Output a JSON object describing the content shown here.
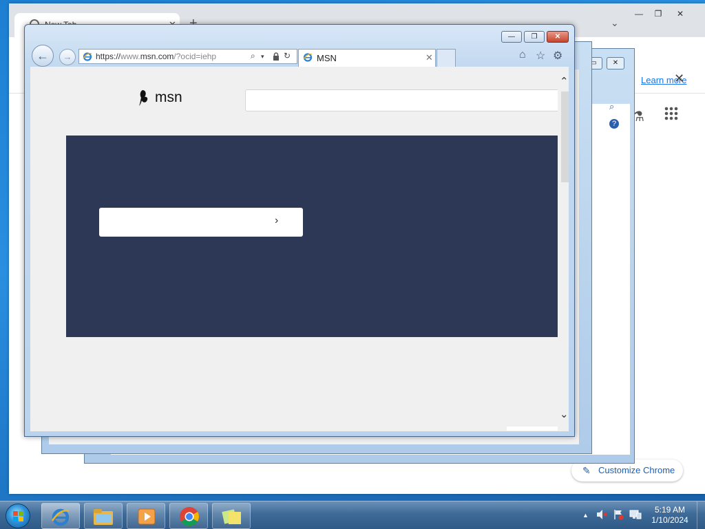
{
  "chrome_window": {
    "tab_title": "New Tab",
    "newtab_glyph": "+",
    "close_glyph": "✕",
    "tab_search_glyph": "⌄",
    "minimize_glyph": "—",
    "maximize_glyph": "❐",
    "close_window_glyph": "✕",
    "infobar_link": "Learn more",
    "infobar_close_glyph": "✕",
    "star_glyph": "☆",
    "menu_glyph": "⋮",
    "labs_glyph": "⚗",
    "customize_label": "Customize Chrome",
    "customize_icon": "pencil-icon"
  },
  "ie_background_window": {
    "caption_buttons": [
      "▭",
      "✕"
    ]
  },
  "ie_window": {
    "caption": {
      "minimize": "—",
      "maximize": "❐",
      "close": "✕"
    },
    "nav": {
      "back_glyph": "←",
      "forward_glyph": "→"
    },
    "address": {
      "url_prefix": "https://",
      "url_host": "www.msn.com",
      "url_path": "/?ocid=iehp",
      "search_glyph": "⌕",
      "dropdown_glyph": "▾",
      "lock_glyph": "🔒",
      "refresh_glyph": "↻"
    },
    "tab": {
      "title": "MSN",
      "close_glyph": "✕"
    },
    "commands": {
      "home_glyph": "⌂",
      "favorites_glyph": "☆",
      "tools_glyph": "⚙"
    },
    "page": {
      "logo_text": "msn",
      "search_placeholder": "",
      "hero_color": "#2c3856",
      "hero_field_chevron": "›"
    },
    "scroll": {
      "up_glyph": "⌃",
      "down_glyph": "⌄"
    }
  },
  "taskbar": {
    "buttons": [
      "internet-explorer",
      "windows-explorer",
      "windows-media-player",
      "google-chrome",
      "sticky-notes"
    ],
    "tray": {
      "expand_glyph": "▲"
    },
    "clock": {
      "time": "5:19 AM",
      "date": "1/10/2024"
    }
  }
}
